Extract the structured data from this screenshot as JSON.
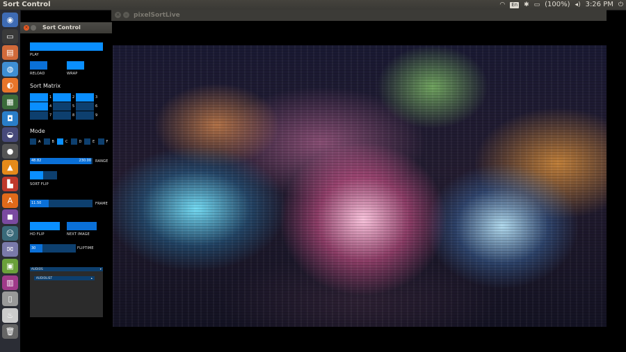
{
  "top_panel": {
    "app_title": "Sort Control",
    "keyboard_layout": "En",
    "battery": "(100%)",
    "time": "3:26 PM",
    "icons": [
      "wifi-icon",
      "keyboard-icon",
      "bluetooth-icon",
      "battery-icon",
      "volume-icon",
      "power-icon"
    ]
  },
  "launcher": {
    "items": [
      {
        "name": "dash-home-icon",
        "glyph": "◉",
        "color": "#3e6bb5"
      },
      {
        "name": "terminal-icon",
        "glyph": "▭",
        "color": "#3a3a3a"
      },
      {
        "name": "files-icon",
        "glyph": "▤",
        "color": "#d16a3a"
      },
      {
        "name": "browser-blue-icon",
        "glyph": "◍",
        "color": "#3f8fd4"
      },
      {
        "name": "firefox-icon",
        "glyph": "◐",
        "color": "#e8752a"
      },
      {
        "name": "system-monitor-icon",
        "glyph": "▦",
        "color": "#3b6b3a"
      },
      {
        "name": "pixel-app-icon",
        "glyph": "◘",
        "color": "#2a7ec9"
      },
      {
        "name": "eclipse-icon",
        "glyph": "◒",
        "color": "#474a7a"
      },
      {
        "name": "webcam-icon",
        "glyph": "●",
        "color": "#555"
      },
      {
        "name": "vlc-icon",
        "glyph": "▲",
        "color": "#e58a1a"
      },
      {
        "name": "paint-icon",
        "glyph": "▙",
        "color": "#c0392b"
      },
      {
        "name": "software-center-icon",
        "glyph": "A",
        "color": "#e06a1a"
      },
      {
        "name": "media-player-icon",
        "glyph": "◼",
        "color": "#7a4aa0"
      },
      {
        "name": "avatar-app-icon",
        "glyph": "☺",
        "color": "#3a6a7a"
      },
      {
        "name": "mail-icon",
        "glyph": "✉",
        "color": "#7a7aaa"
      },
      {
        "name": "image-viewer-icon",
        "glyph": "▣",
        "color": "#6aa03a"
      },
      {
        "name": "slides-icon",
        "glyph": "▥",
        "color": "#a03a8a"
      },
      {
        "name": "usb-drive-icon",
        "glyph": "▯",
        "color": "#999"
      },
      {
        "name": "java-icon",
        "glyph": "♨",
        "color": "#ccc"
      },
      {
        "name": "trash-icon",
        "glyph": "🗑",
        "color": "#666"
      }
    ]
  },
  "main_window": {
    "title": "pixelSortLive"
  },
  "control_window": {
    "title": "Sort Control",
    "play_label": "PLAY",
    "reload_label": "RELOAD",
    "wrap_label": "WRAP",
    "matrix_title": "Sort Matrix",
    "matrix": [
      {
        "label": "1",
        "on": true
      },
      {
        "label": "2",
        "on": true
      },
      {
        "label": "3",
        "on": true
      },
      {
        "label": "4",
        "on": true
      },
      {
        "label": "5",
        "on": false
      },
      {
        "label": "6",
        "on": false
      },
      {
        "label": "7",
        "on": false
      },
      {
        "label": "8",
        "on": false
      },
      {
        "label": "9",
        "on": false
      }
    ],
    "mode_title": "Mode",
    "modes": [
      {
        "label": "A",
        "on": false
      },
      {
        "label": "B",
        "on": false
      },
      {
        "label": "C",
        "on": true
      },
      {
        "label": "D",
        "on": false
      },
      {
        "label": "E",
        "on": false
      },
      {
        "label": "F",
        "on": false
      }
    ],
    "range": {
      "low": "48.82",
      "high": "230.00",
      "label": "RANGE",
      "fill_start": 0.0,
      "fill_end": 0.98
    },
    "sort_flip_label": "SORT FLIP",
    "frame": {
      "value": "11.50",
      "label": "FRAME",
      "fill": 0.3
    },
    "hd_flip_label": "HD FLIP",
    "next_image_label": "NEXT IMAGE",
    "flip_time": {
      "value": "30",
      "label": "FLIPTIME",
      "fill": 0.28
    },
    "midi_header": "AUDIOS",
    "midi_dropdown": "AUDIOLIST"
  }
}
